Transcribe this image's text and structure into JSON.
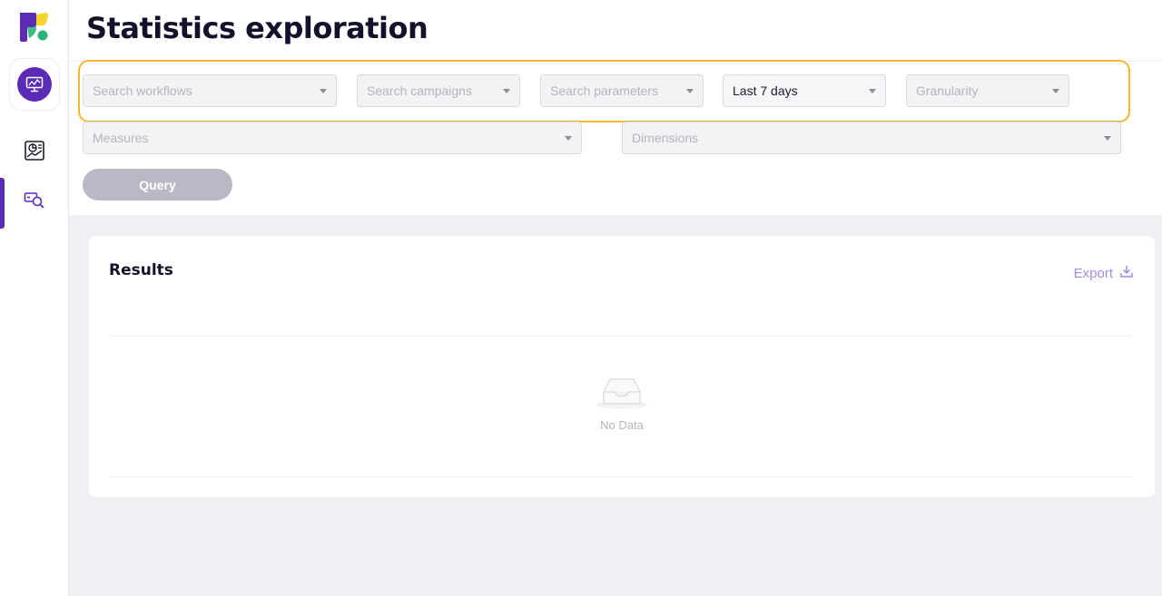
{
  "page": {
    "title": "Statistics exploration"
  },
  "sidebar": {
    "logo_icon": "brand-logo-icon",
    "app_icon": "analytics-monitor-icon",
    "items": [
      {
        "name": "dashboard",
        "icon": "chart-report-icon",
        "active": false
      },
      {
        "name": "exploration",
        "icon": "search-data-icon",
        "active": true
      }
    ]
  },
  "filters": {
    "workflows": {
      "placeholder": "Search workflows",
      "value": ""
    },
    "campaigns": {
      "placeholder": "Search campaigns",
      "value": ""
    },
    "parameters": {
      "placeholder": "Search parameters",
      "value": ""
    },
    "period": {
      "value": "Last 7 days"
    },
    "granularity": {
      "placeholder": "Granularity",
      "value": ""
    },
    "measures": {
      "placeholder": "Measures",
      "value": ""
    },
    "dimensions": {
      "placeholder": "Dimensions",
      "value": ""
    }
  },
  "query_button": {
    "label": "Query"
  },
  "results": {
    "title": "Results",
    "export_label": "Export",
    "empty_text": "No Data"
  },
  "colors": {
    "accent": "#5b2bb5",
    "highlight": "#f5b82e",
    "export": "#a58ae0",
    "logo_green": "#2bb57a",
    "logo_yellow": "#f5d42e"
  }
}
